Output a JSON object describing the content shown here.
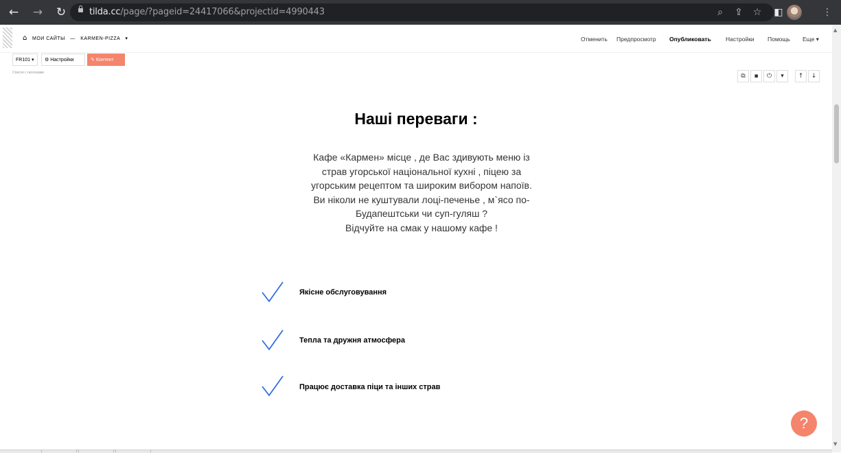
{
  "browser": {
    "url_domain": "tilda.cc",
    "url_path": "/page/?pageid=24417066&projectid=4990443"
  },
  "tilda_header": {
    "breadcrumb_sites": "МОИ САЙТЫ",
    "breadcrumb_separator": "—",
    "breadcrumb_project": "KARMEN-PIZZA",
    "dropdown_arrow": "▾",
    "menu": {
      "cancel": "Отменить",
      "preview": "Предпросмотр",
      "publish": "Опубликовать",
      "settings": "Настройки",
      "help": "Помощь",
      "more": "Еще"
    }
  },
  "block_toolbar": {
    "block_id": "FR101",
    "settings": "Настройки",
    "content": "Контент",
    "note": "Список с галочками"
  },
  "content": {
    "heading": "Наші переваги :",
    "paragraph_lines": [
      "Кафе «Кармен» місце , де Вас здивують меню із",
      "страв угорської національної кухні , піцею за",
      "угорським рецептом та широким вибором напоїв.",
      "Ви ніколи не куштували лоці-печенье , м`ясо по-",
      "Будапештськи чи суп-гуляш ?",
      "Відчуйте на смак у нашому кафе !"
    ],
    "features": [
      "Якісне обслуговування",
      "Тепла та дружня атмосфера",
      "Працює доставка піци та інших страв"
    ]
  },
  "help_button": "?",
  "colors": {
    "chrome_dark": "#35363a",
    "accent_coral": "#f4846b",
    "check_blue": "#2f6fe0"
  },
  "icons": [
    "back-arrow-icon",
    "forward-arrow-icon",
    "reload-icon",
    "lock-icon",
    "zoom-icon",
    "share-icon",
    "star-icon",
    "sidepanel-icon",
    "profile-avatar",
    "kebab-menu-icon",
    "home-icon",
    "gear-icon",
    "pencil-icon",
    "copy-icon",
    "trash-icon",
    "power-icon",
    "arrow-up-icon",
    "arrow-down-icon",
    "check-icon"
  ]
}
